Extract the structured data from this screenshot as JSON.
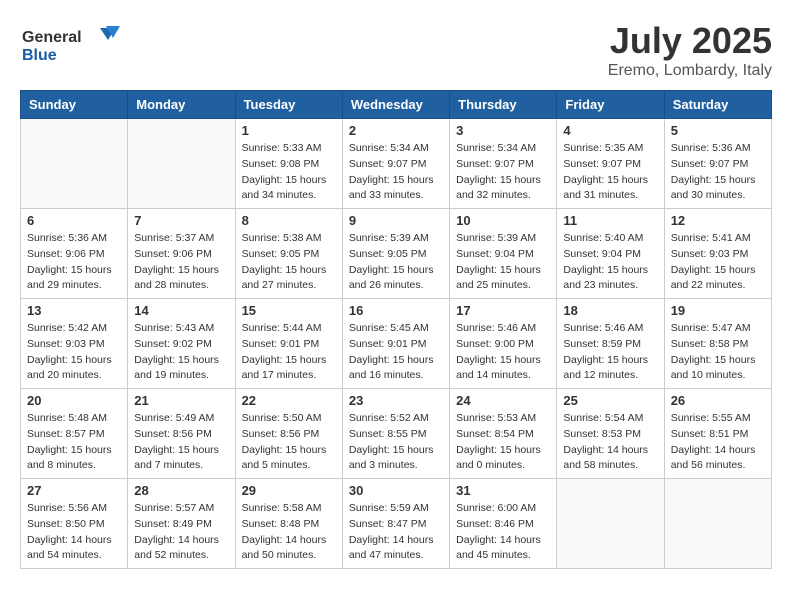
{
  "header": {
    "logo_general": "General",
    "logo_blue": "Blue",
    "month_year": "July 2025",
    "location": "Eremo, Lombardy, Italy"
  },
  "days_of_week": [
    "Sunday",
    "Monday",
    "Tuesday",
    "Wednesday",
    "Thursday",
    "Friday",
    "Saturday"
  ],
  "weeks": [
    [
      {
        "day": "",
        "info": ""
      },
      {
        "day": "",
        "info": ""
      },
      {
        "day": "1",
        "info": "Sunrise: 5:33 AM\nSunset: 9:08 PM\nDaylight: 15 hours\nand 34 minutes."
      },
      {
        "day": "2",
        "info": "Sunrise: 5:34 AM\nSunset: 9:07 PM\nDaylight: 15 hours\nand 33 minutes."
      },
      {
        "day": "3",
        "info": "Sunrise: 5:34 AM\nSunset: 9:07 PM\nDaylight: 15 hours\nand 32 minutes."
      },
      {
        "day": "4",
        "info": "Sunrise: 5:35 AM\nSunset: 9:07 PM\nDaylight: 15 hours\nand 31 minutes."
      },
      {
        "day": "5",
        "info": "Sunrise: 5:36 AM\nSunset: 9:07 PM\nDaylight: 15 hours\nand 30 minutes."
      }
    ],
    [
      {
        "day": "6",
        "info": "Sunrise: 5:36 AM\nSunset: 9:06 PM\nDaylight: 15 hours\nand 29 minutes."
      },
      {
        "day": "7",
        "info": "Sunrise: 5:37 AM\nSunset: 9:06 PM\nDaylight: 15 hours\nand 28 minutes."
      },
      {
        "day": "8",
        "info": "Sunrise: 5:38 AM\nSunset: 9:05 PM\nDaylight: 15 hours\nand 27 minutes."
      },
      {
        "day": "9",
        "info": "Sunrise: 5:39 AM\nSunset: 9:05 PM\nDaylight: 15 hours\nand 26 minutes."
      },
      {
        "day": "10",
        "info": "Sunrise: 5:39 AM\nSunset: 9:04 PM\nDaylight: 15 hours\nand 25 minutes."
      },
      {
        "day": "11",
        "info": "Sunrise: 5:40 AM\nSunset: 9:04 PM\nDaylight: 15 hours\nand 23 minutes."
      },
      {
        "day": "12",
        "info": "Sunrise: 5:41 AM\nSunset: 9:03 PM\nDaylight: 15 hours\nand 22 minutes."
      }
    ],
    [
      {
        "day": "13",
        "info": "Sunrise: 5:42 AM\nSunset: 9:03 PM\nDaylight: 15 hours\nand 20 minutes."
      },
      {
        "day": "14",
        "info": "Sunrise: 5:43 AM\nSunset: 9:02 PM\nDaylight: 15 hours\nand 19 minutes."
      },
      {
        "day": "15",
        "info": "Sunrise: 5:44 AM\nSunset: 9:01 PM\nDaylight: 15 hours\nand 17 minutes."
      },
      {
        "day": "16",
        "info": "Sunrise: 5:45 AM\nSunset: 9:01 PM\nDaylight: 15 hours\nand 16 minutes."
      },
      {
        "day": "17",
        "info": "Sunrise: 5:46 AM\nSunset: 9:00 PM\nDaylight: 15 hours\nand 14 minutes."
      },
      {
        "day": "18",
        "info": "Sunrise: 5:46 AM\nSunset: 8:59 PM\nDaylight: 15 hours\nand 12 minutes."
      },
      {
        "day": "19",
        "info": "Sunrise: 5:47 AM\nSunset: 8:58 PM\nDaylight: 15 hours\nand 10 minutes."
      }
    ],
    [
      {
        "day": "20",
        "info": "Sunrise: 5:48 AM\nSunset: 8:57 PM\nDaylight: 15 hours\nand 8 minutes."
      },
      {
        "day": "21",
        "info": "Sunrise: 5:49 AM\nSunset: 8:56 PM\nDaylight: 15 hours\nand 7 minutes."
      },
      {
        "day": "22",
        "info": "Sunrise: 5:50 AM\nSunset: 8:56 PM\nDaylight: 15 hours\nand 5 minutes."
      },
      {
        "day": "23",
        "info": "Sunrise: 5:52 AM\nSunset: 8:55 PM\nDaylight: 15 hours\nand 3 minutes."
      },
      {
        "day": "24",
        "info": "Sunrise: 5:53 AM\nSunset: 8:54 PM\nDaylight: 15 hours\nand 0 minutes."
      },
      {
        "day": "25",
        "info": "Sunrise: 5:54 AM\nSunset: 8:53 PM\nDaylight: 14 hours\nand 58 minutes."
      },
      {
        "day": "26",
        "info": "Sunrise: 5:55 AM\nSunset: 8:51 PM\nDaylight: 14 hours\nand 56 minutes."
      }
    ],
    [
      {
        "day": "27",
        "info": "Sunrise: 5:56 AM\nSunset: 8:50 PM\nDaylight: 14 hours\nand 54 minutes."
      },
      {
        "day": "28",
        "info": "Sunrise: 5:57 AM\nSunset: 8:49 PM\nDaylight: 14 hours\nand 52 minutes."
      },
      {
        "day": "29",
        "info": "Sunrise: 5:58 AM\nSunset: 8:48 PM\nDaylight: 14 hours\nand 50 minutes."
      },
      {
        "day": "30",
        "info": "Sunrise: 5:59 AM\nSunset: 8:47 PM\nDaylight: 14 hours\nand 47 minutes."
      },
      {
        "day": "31",
        "info": "Sunrise: 6:00 AM\nSunset: 8:46 PM\nDaylight: 14 hours\nand 45 minutes."
      },
      {
        "day": "",
        "info": ""
      },
      {
        "day": "",
        "info": ""
      }
    ]
  ]
}
